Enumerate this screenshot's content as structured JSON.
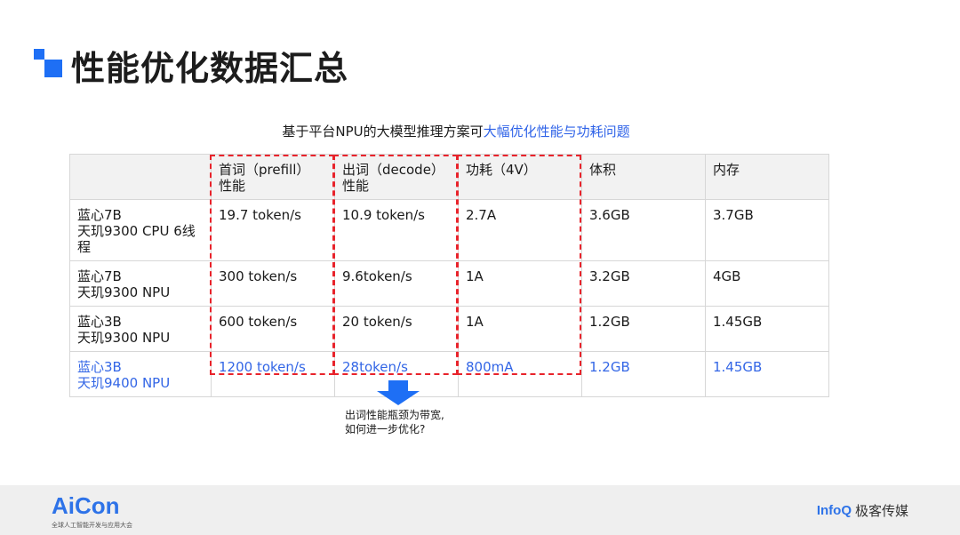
{
  "title": "性能优化数据汇总",
  "subtitle": {
    "prefix": "基于平台NPU的大模型推理方案可",
    "highlight": "大幅优化性能与功耗问题"
  },
  "table": {
    "headers": [
      "",
      "首词（prefill）\n性能",
      "出词（decode）\n性能",
      "功耗（4V）",
      "体积",
      "内存"
    ],
    "rows": [
      [
        "蓝心7B\n天玑9300 CPU 6线\n程",
        "19.7 token/s",
        "10.9 token/s",
        "2.7A",
        "3.6GB",
        "3.7GB"
      ],
      [
        "蓝心7B\n天玑9300  NPU",
        "300 token/s",
        "9.6token/s",
        "1A",
        "3.2GB",
        "4GB"
      ],
      [
        "蓝心3B\n天玑9300  NPU",
        "600 token/s",
        "20 token/s",
        "1A",
        "1.2GB",
        "1.45GB"
      ],
      [
        "蓝心3B\n天玑9400  NPU",
        "1200 token/s",
        "28token/s",
        "800mA",
        "1.2GB",
        "1.45GB"
      ]
    ]
  },
  "note": "出词性能瓶颈为带宽,\n如何进一步优化?",
  "footer": {
    "logo": "AiCon",
    "logo_sub": "全球人工智能开发与应用大会",
    "brand": "InfoQ",
    "brand_cn": "极客传媒"
  },
  "colors": {
    "accent": "#2f63e8",
    "highlight_row": "#3366e6",
    "dashed_box": "#e8232b",
    "header_bg": "#f2f2f2"
  }
}
